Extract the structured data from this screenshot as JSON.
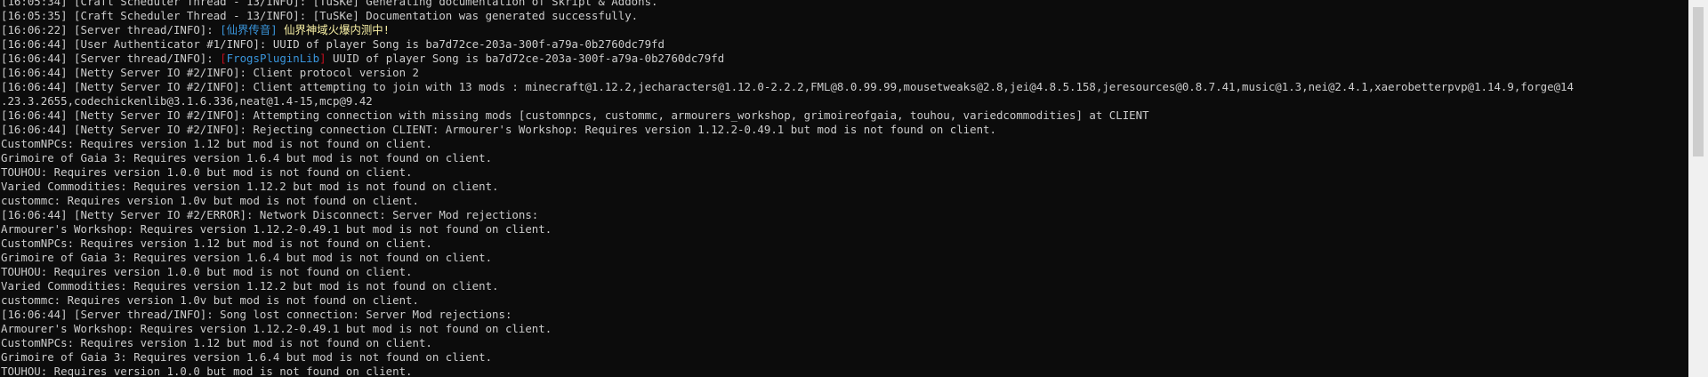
{
  "console": {
    "colors": {
      "background": "#0c0c0c",
      "text": "#cccccc",
      "cyan": "#3a96dd",
      "yellow": "#f9f1a5",
      "red": "#c50f1f",
      "scrollbar_track": "#f0f0f0",
      "scrollbar_thumb": "#cdcdcd"
    },
    "lines": [
      "[16:05:34] [Craft Scheduler Thread - 13/INFO]: [TuSKe] Generating documentation of Skript & Addons.",
      "[16:05:35] [Craft Scheduler Thread - 13/INFO]: [TuSKe] Documentation was generated successfully.",
      "[16:06:44] [User Authenticator #1/INFO]: UUID of player Song is ba7d72ce-203a-300f-a79a-0b2760dc79fd",
      "[16:06:44] [Netty Server IO #2/INFO]: Client protocol version 2",
      "[16:06:44] [Netty Server IO #2/INFO]: Client attempting to join with 13 mods : minecraft@1.12.2,jecharacters@1.12.0-2.2.2,FML@8.0.99.99,mousetweaks@2.8,jei@4.8.5.158,jeresources@0.8.7.41,music@1.3,nei@2.4.1,xaerobetterpvp@1.14.9,forge@14",
      ".23.3.2655,codechickenlib@3.1.6.336,neat@1.4-15,mcp@9.42",
      "[16:06:44] [Netty Server IO #2/INFO]: Attempting connection with missing mods [customnpcs, custommc, armourers_workshop, grimoireofgaia, touhou, variedcommodities] at CLIENT",
      "[16:06:44] [Netty Server IO #2/INFO]: Rejecting connection CLIENT: Armourer's Workshop: Requires version 1.12.2-0.49.1 but mod is not found on client.",
      "CustomNPCs: Requires version 1.12 but mod is not found on client.",
      "Grimoire of Gaia 3: Requires version 1.6.4 but mod is not found on client.",
      "TOUHOU: Requires version 1.0.0 but mod is not found on client.",
      "Varied Commodities: Requires version 1.12.2 but mod is not found on client.",
      "custommc: Requires version 1.0v but mod is not found on client.",
      "[16:06:44] [Netty Server IO #2/ERROR]: Network Disconnect: Server Mod rejections:",
      "Armourer's Workshop: Requires version 1.12.2-0.49.1 but mod is not found on client.",
      "CustomNPCs: Requires version 1.12 but mod is not found on client.",
      "Grimoire of Gaia 3: Requires version 1.6.4 but mod is not found on client.",
      "TOUHOU: Requires version 1.0.0 but mod is not found on client.",
      "Varied Commodities: Requires version 1.12.2 but mod is not found on client.",
      "custommc: Requires version 1.0v but mod is not found on client.",
      "[16:06:44] [Server thread/INFO]: Song lost connection: Server Mod rejections:",
      "Armourer's Workshop: Requires version 1.12.2-0.49.1 but mod is not found on client.",
      "CustomNPCs: Requires version 1.12 but mod is not found on client.",
      "Grimoire of Gaia 3: Requires version 1.6.4 but mod is not found on client.",
      "TOUHOU: Requires version 1.0.0 but mod is not found on client."
    ],
    "special": {
      "line3": {
        "prefix": "[16:06:22] [Server thread/INFO]: ",
        "tag": "[仙界传音]",
        "message": " 仙界神域火爆内测中!"
      },
      "line5": {
        "prefix": "[16:06:44] [Server thread/INFO]: ",
        "tag_open": "[",
        "tag_name": "FrogsPluginLib",
        "tag_close": "]",
        "message": " UUID of player Song is ba7d72ce-203a-300f-a79a-0b2760dc79fd"
      }
    }
  }
}
